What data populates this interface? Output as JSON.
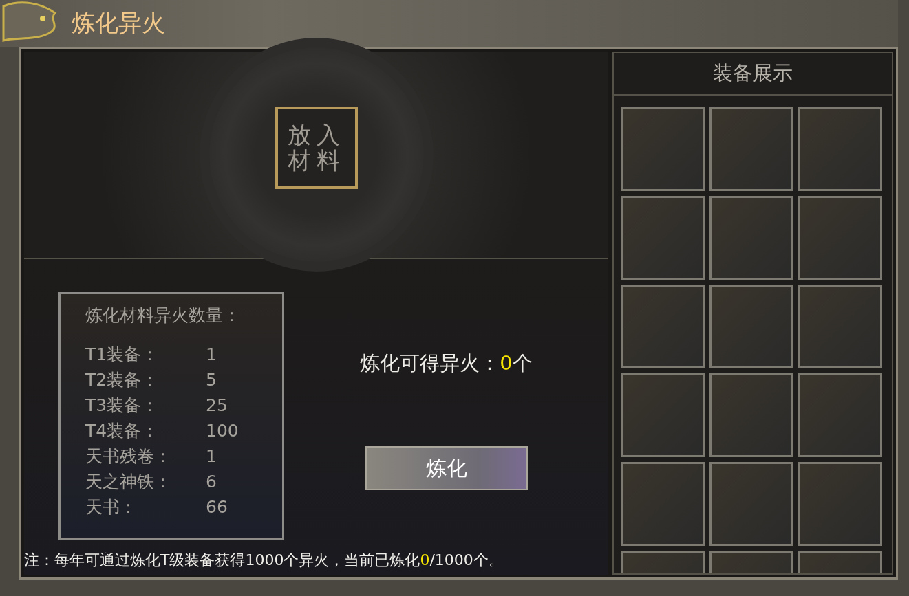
{
  "window": {
    "title": "炼化异火"
  },
  "material_slot": {
    "label": "放入材料"
  },
  "materials": {
    "title": "炼化材料异火数量：",
    "rows": [
      {
        "name": "T1装备：",
        "value": "1"
      },
      {
        "name": "T2装备：",
        "value": "5"
      },
      {
        "name": "T3装备：",
        "value": "25"
      },
      {
        "name": "T4装备：",
        "value": "100"
      },
      {
        "name": "天书残卷：",
        "value": "1"
      },
      {
        "name": "天之神铁：",
        "value": "6"
      },
      {
        "name": "天书：",
        "value": "66"
      }
    ]
  },
  "result": {
    "label": "炼化可得异火：",
    "value": "0",
    "unit": "个"
  },
  "refine_button": {
    "label": "炼化"
  },
  "note": {
    "prefix": "注：每年可通过炼化T级装备获得1000个异火，当前已炼化",
    "count": "0",
    "suffix": "/1000个。"
  },
  "equipment": {
    "title": "装备展示"
  }
}
